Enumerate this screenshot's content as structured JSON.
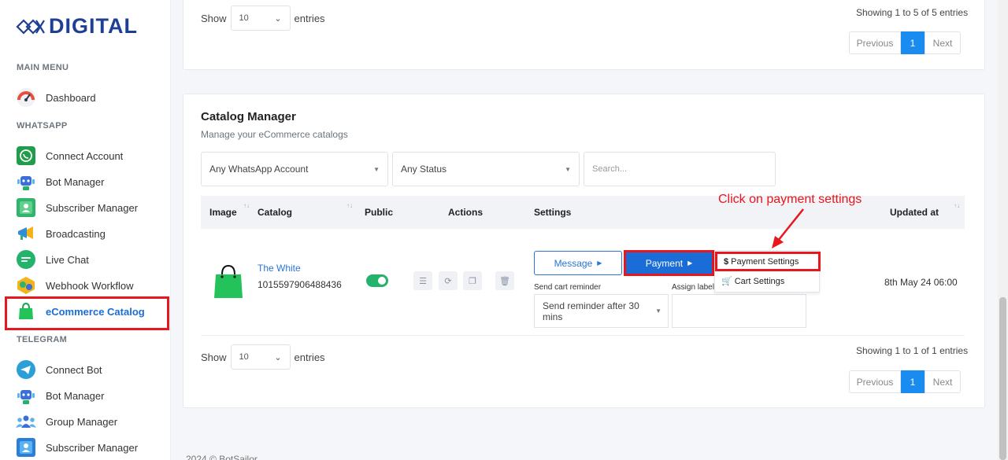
{
  "brand": {
    "name": "DIGITAL"
  },
  "sidebar": {
    "sections": {
      "main": "MAIN MENU",
      "whatsapp": "WHATSAPP",
      "telegram": "TELEGRAM"
    },
    "items": [
      {
        "label": "Dashboard",
        "icon": "gauge-icon"
      },
      {
        "label": "Connect Account",
        "icon": "whatsapp-icon"
      },
      {
        "label": "Bot Manager",
        "icon": "robot-icon"
      },
      {
        "label": "Subscriber Manager",
        "icon": "subscriber-icon"
      },
      {
        "label": "Broadcasting",
        "icon": "broadcast-icon"
      },
      {
        "label": "Live Chat",
        "icon": "chat-icon"
      },
      {
        "label": "Webhook Workflow",
        "icon": "webhook-icon"
      },
      {
        "label": "eCommerce Catalog",
        "icon": "shopping-bag-icon",
        "active": true
      },
      {
        "label": "Connect Bot",
        "icon": "telegram-icon"
      },
      {
        "label": "Bot Manager",
        "icon": "robot-icon"
      },
      {
        "label": "Group Manager",
        "icon": "group-icon"
      },
      {
        "label": "Subscriber Manager",
        "icon": "subscriber-icon"
      }
    ]
  },
  "top_table": {
    "show": "Show",
    "entries_value": "10",
    "entries": "entries",
    "info": "Showing 1 to 5 of 5 entries",
    "pager": {
      "prev": "Previous",
      "current": "1",
      "next": "Next"
    }
  },
  "catalog": {
    "title": "Catalog Manager",
    "subtitle": "Manage your eCommerce catalogs",
    "filters": {
      "account": "Any WhatsApp Account",
      "status": "Any Status",
      "search_placeholder": "Search..."
    },
    "columns": [
      "Image",
      "Catalog",
      "Public",
      "Actions",
      "Settings",
      "Updated at"
    ],
    "row": {
      "name": "The White",
      "id": "1015597906488436",
      "message_btn": "Message",
      "payment_btn": "Payment",
      "cart_reminder_label": "Send cart reminder",
      "assign_label": "Assign label",
      "reminder_value": "Send reminder after 30 mins",
      "updated": "8th May 24 06:00"
    },
    "dropdown": {
      "payment_settings": "Payment Settings",
      "cart_settings": "Cart Settings"
    },
    "bottom": {
      "show": "Show",
      "entries_value": "10",
      "entries": "entries",
      "info": "Showing 1 to 1 of 1 entries",
      "pager": {
        "prev": "Previous",
        "current": "1",
        "next": "Next"
      }
    }
  },
  "annotation": "Click on payment settings",
  "footer": "2024 © BotSailor",
  "colors": {
    "accent": "#1a6dd6",
    "highlight": "#e8161d",
    "toggle": "#24b36b"
  }
}
